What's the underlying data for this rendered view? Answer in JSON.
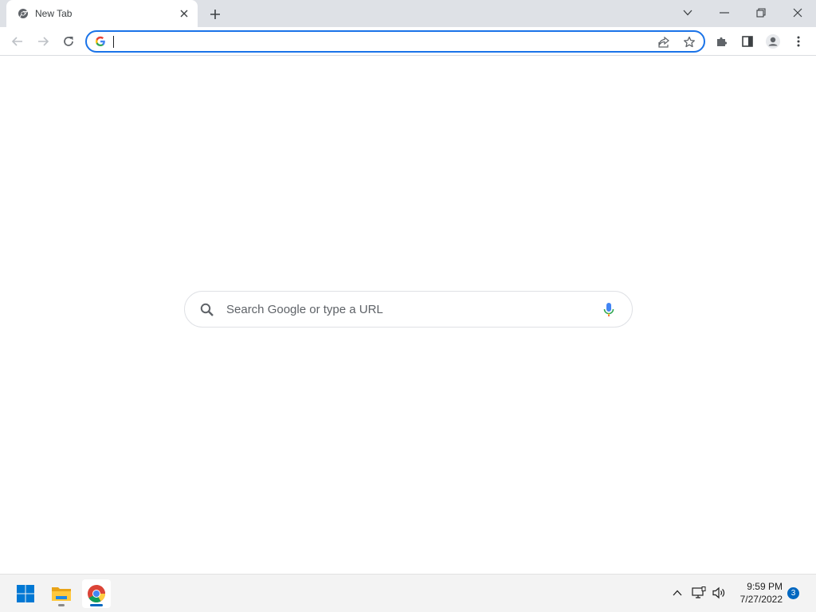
{
  "tab": {
    "title": "New Tab"
  },
  "omnibox": {
    "value": "",
    "placeholder": ""
  },
  "ntp": {
    "search_placeholder": "Search Google or type a URL"
  },
  "icons": {
    "tab_favicon": "chrome-icon",
    "tab_close": "close-icon",
    "new_tab": "plus-icon",
    "tab_search": "chevron-down-icon",
    "minimize": "minimize-icon",
    "restore": "restore-icon",
    "close_window": "close-icon",
    "back": "back-arrow-icon",
    "forward": "forward-arrow-icon",
    "reload": "reload-icon",
    "google": "google-g-icon",
    "share": "share-icon",
    "bookmark": "star-icon",
    "extensions": "puzzle-icon",
    "side_panel": "side-panel-icon",
    "profile": "profile-icon",
    "menu": "kebab-menu-icon",
    "search": "search-icon",
    "voice": "microphone-icon"
  },
  "taskbar": {
    "apps": [
      "Start",
      "File Explorer",
      "Google Chrome"
    ],
    "time": "9:59 PM",
    "date": "7/27/2022",
    "notification_count": "3"
  },
  "colors": {
    "accent": "#1a73e8",
    "tabstrip_bg": "#dee1e6",
    "taskbar_bg": "#f3f3f3",
    "windows_blue": "#0067c0"
  }
}
